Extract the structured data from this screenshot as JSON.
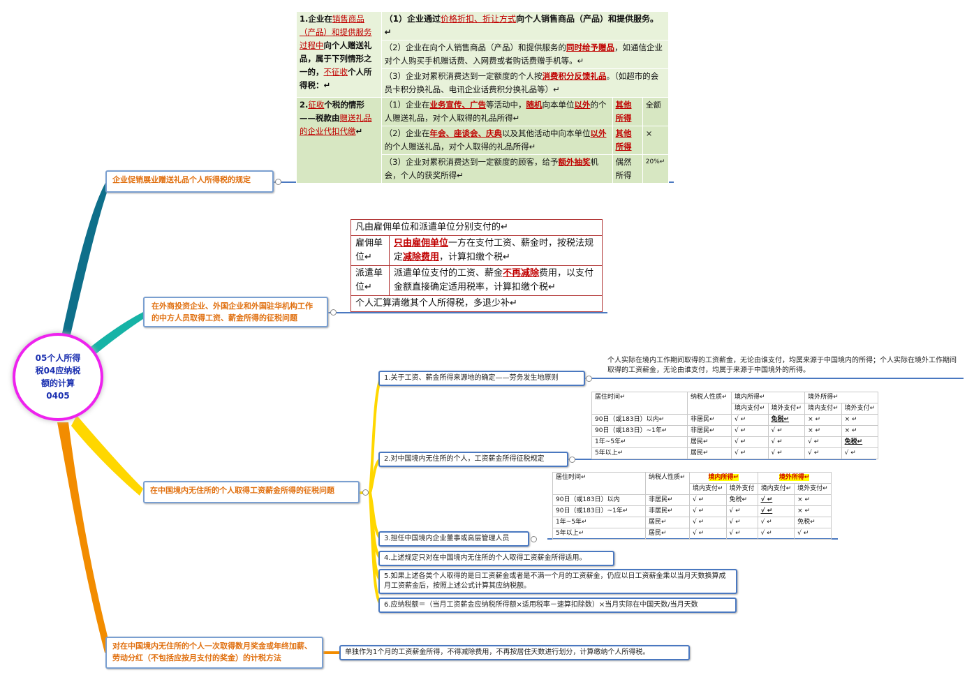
{
  "center": {
    "text": "05个人所得税04应纳税额的计算0405"
  },
  "topics": {
    "t1": "企业促销展业赠送礼品个人所得税的规定",
    "t2": "在外商投资企业、外国企业和外国驻华机构工作的中方人员取得工资、薪金所得的征税问题",
    "t3": "在中国境内无住所的个人取得工资薪金所得的征税问题",
    "t4": "对在中国境内无住所的个人一次取得数月奖金或年终加薪、劳动分红（不包括应按月支付的奖金）的计税方法"
  },
  "gift_table": {
    "group1": {
      "label_parts": [
        "1.企业在",
        "销售商品（产品）和提供服务过程中",
        "向个人赠送礼品，属于下列情形之一的，",
        "不征收",
        "个人所得税：↵"
      ],
      "rows": [
        {
          "parts": [
            "（1）企业通过",
            "价格折扣、折让方式",
            "向个人销售商品（产品）和提供服务。↵"
          ]
        },
        {
          "parts": [
            "（2）企业在向个人销售商品（产品）和提供服务的",
            "同时给予赠品",
            "，如通信企业对个人购买手机赠话费、入网费或者购话费赠手机等。↵"
          ]
        },
        {
          "parts": [
            "（3）企业对累积消费达到一定额度的个人按",
            "消费积分反馈礼品",
            "。（如超市的会员卡积分换礼品、电讯企业话费积分换礼品等）↵"
          ]
        }
      ]
    },
    "group2": {
      "label_parts": [
        "2.",
        "征收",
        "个税的情形——税款由",
        "赠送礼品的企业代扣代缴",
        "↵"
      ],
      "rows": [
        {
          "parts": [
            "（1）企业在",
            "业务宣传、广告",
            "等活动中，",
            "随机",
            "向本单位",
            "以外",
            "的个人赠送礼品，对个人取得的礼品所得↵"
          ],
          "category": "其他所得",
          "rate": "全额"
        },
        {
          "parts": [
            "（2）企业在",
            "年会、座谈会、庆典",
            "以及其他活动中向本单位",
            "以外",
            "的个人赠送礼品，对个人取得的礼品所得↵"
          ],
          "category": "其他所得",
          "rate": "×"
        },
        {
          "parts": [
            "（3）企业对累积消费达到一定额度的顾客，给予",
            "额外抽奖",
            "机会，个人的获奖所得↵"
          ],
          "category": "偶然所得",
          "rate": "20%↵"
        }
      ]
    }
  },
  "salary_table": {
    "header": "凡由雇佣单位和派遣单位分别支付的↵",
    "rows": [
      {
        "label": "雇佣单位↵",
        "parts": [
          "只由雇佣单位",
          "一方在支付工资、薪金时，按税法规定",
          "减除费用",
          "，计算扣缴个税↵"
        ]
      },
      {
        "label": "派遣单位↵",
        "parts": [
          "派遣单位支付的工资、薪金",
          "不再减除",
          "费用，以支付金额直接确定适用税率，计算扣缴个税↵"
        ]
      }
    ],
    "footer": "个人汇算清缴其个人所得税，多退少补↵"
  },
  "subs": {
    "s1": "1.关于工资、薪金所得来源地的确定——劳务发生地原则",
    "s1_note": "个人实际在境内工作期间取得的工资薪金，无论由谁支付，均属来源于中国境内的所得；个人实际在境外工作期间取得的工资薪金，无论由谁支付，均属于来源于中国境外的所得。",
    "s2": "2.对中国境内无住所的个人，工资薪金所得征税规定",
    "s3": "3.担任中国境内企业董事或高层管理人员",
    "s4": "4.上述规定只对在中国境内无住所的个人取得工资薪金所得适用。",
    "s5": "5.如果上述各类个人取得的是日工资薪金或者是不满一个月的工资薪金，仍应以日工资薪金乘以当月天数换算成月工资薪金后，按照上述公式计算其应纳税额。",
    "s6": "6.应纳税额＝（当月工资薪金应纳税所得额×适用税率－速算扣除数）×当月实际在中国天数/当月天数",
    "s7": "单独作为1个月的工资薪金所得，不得减除费用，不再按居住天数进行划分，计算缴纳个人所得税。"
  },
  "residency_table_1": {
    "h1": "居住时间↵",
    "h2": "纳税人性质↵",
    "h3": "境内所得↵",
    "h4": "境外所得↵",
    "sub": [
      "境内支付↵",
      "境外支付↵",
      "境内支付↵",
      "境外支付↵"
    ],
    "rows": [
      [
        "90日（或183日）以内↵",
        "非居民↵",
        "√ ↵",
        "免税↵",
        "× ↵",
        "× ↵"
      ],
      [
        "90日（或183日）~1年↵",
        "非居民↵",
        "√ ↵",
        "√ ↵",
        "× ↵",
        "× ↵"
      ],
      [
        "1年~5年↵",
        "居民↵",
        "√ ↵",
        "√ ↵",
        "√ ↵",
        "免税↵"
      ],
      [
        "5年以上↵",
        "居民↵",
        "√ ↵",
        "√ ↵",
        "√ ↵",
        "√ ↵"
      ]
    ]
  },
  "residency_table_2": {
    "h1": "居住时间↵",
    "h2": "纳税人性质↵",
    "h3": "境内所得↵",
    "h4": "境外所得↵",
    "sub": [
      "境内支付↵",
      "境外支付",
      "境内支付↵",
      "境外支付↵"
    ],
    "rows": [
      [
        "90日（或183日）以内",
        "非居民↵",
        "√ ↵",
        "免税↵",
        "√ ↵",
        "× ↵"
      ],
      [
        "90日（或183日）~1年↵",
        "非居民↵",
        "√ ↵",
        "√ ↵",
        "√ ↵",
        "× ↵"
      ],
      [
        "1年~5年↵",
        "居民↵",
        "√ ↵",
        "√ ↵",
        "√ ↵",
        "免税↵"
      ],
      [
        "5年以上↵",
        "居民↵",
        "√ ↵",
        "√ ↵",
        "√ ↵",
        "√ ↵"
      ]
    ]
  },
  "colors": {
    "branch_teal_dark": "#0e6f8a",
    "branch_teal": "#16b3a6",
    "branch_yellow": "#ffd700",
    "branch_orange": "#f28c00",
    "center_border": "#ee22ee",
    "topic_text": "#e07010",
    "highlight_red": "#c00000"
  }
}
